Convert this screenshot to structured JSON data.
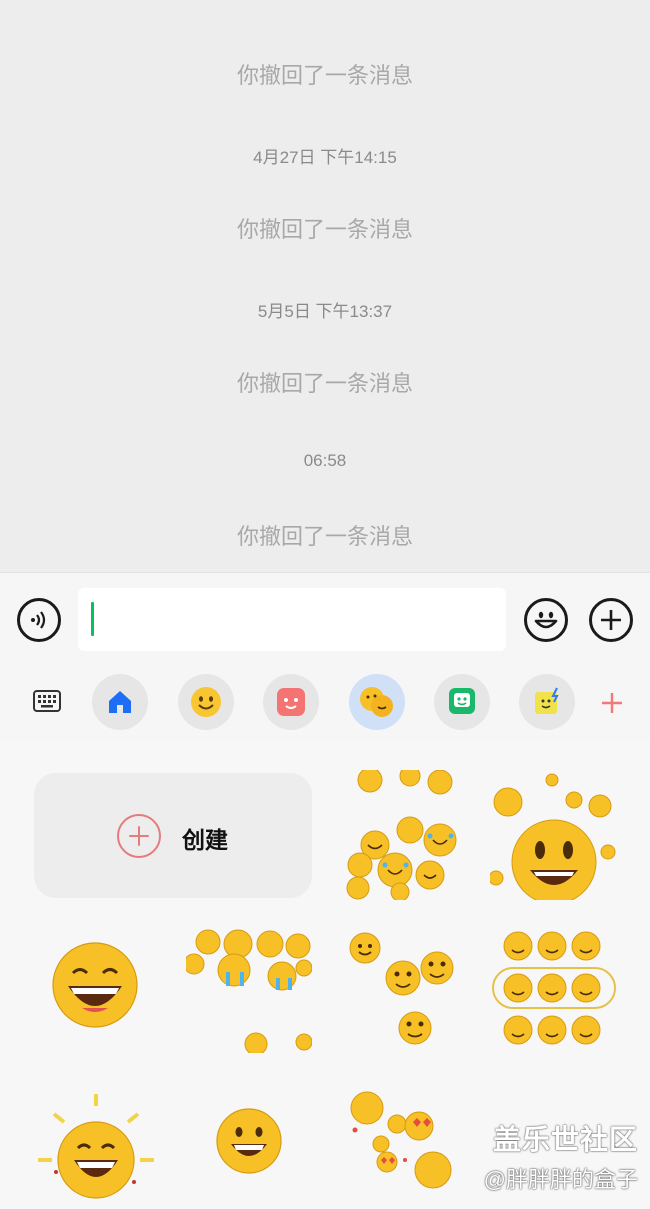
{
  "chat": {
    "messages": [
      {
        "type": "system",
        "text": "你撤回了一条消息"
      },
      {
        "type": "time",
        "text": "4月27日 下午14:15"
      },
      {
        "type": "system",
        "text": "你撤回了一条消息"
      },
      {
        "type": "time",
        "text": "5月5日 下午13:37"
      },
      {
        "type": "system",
        "text": "你撤回了一条消息"
      },
      {
        "type": "time",
        "text": "06:58"
      },
      {
        "type": "system",
        "text": "你撤回了一条消息"
      }
    ]
  },
  "input": {
    "voice_icon": "voice-icon",
    "emoji_icon": "emoji-icon",
    "plus_icon": "plus-icon",
    "value": ""
  },
  "panel": {
    "tabs": [
      {
        "icon": "keyboard-icon"
      },
      {
        "icon": "home-icon"
      },
      {
        "icon": "smiley-icon"
      },
      {
        "icon": "pink-face-icon"
      },
      {
        "icon": "bean-emoji-icon",
        "active": true
      },
      {
        "icon": "green-bot-icon"
      },
      {
        "icon": "yellow-note-icon"
      },
      {
        "icon": "add-icon"
      }
    ],
    "create_label": "创建",
    "accent": "#e67b7b",
    "active_tab_bg": "#cfe0f7"
  },
  "watermark": {
    "line1": "盖乐世社区",
    "line2": "@胖胖胖的盒子"
  }
}
